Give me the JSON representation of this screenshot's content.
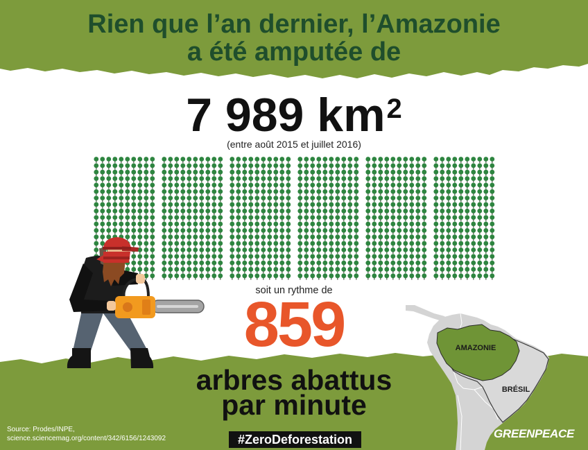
{
  "title": {
    "line1": "Rien que l’an dernier, l’Amazonie",
    "line2": "a été amputée de"
  },
  "area": {
    "value": "7 989 km",
    "exponent": "2",
    "period": "(entre août 2015 et juillet 2016)"
  },
  "rate": {
    "intro": "soit un rythme de",
    "value": "859",
    "unit_line1": "arbres abattus",
    "unit_line2": "par minute"
  },
  "map": {
    "region_label": "AMAZONIE",
    "country_label": "BRÉSIL"
  },
  "footer": {
    "source_line1": "Source: Prodes/INPE,",
    "source_line2": "science.sciencemag.org/content/342/6156/1243092",
    "hashtag": "#ZeroDeforestation",
    "logo": "GREENPEACE"
  },
  "colors": {
    "background_green": "#7d9b3c",
    "title_green": "#1f4e2c",
    "accent_orange": "#e8562a",
    "tree_green": "#2e8540",
    "region_green": "#6f9436"
  },
  "icons": {
    "pictogram": "tree-icon",
    "illustration": "lumberjack-with-chainsaw",
    "map": "south-america-map",
    "logo": "greenpeace-logo"
  }
}
